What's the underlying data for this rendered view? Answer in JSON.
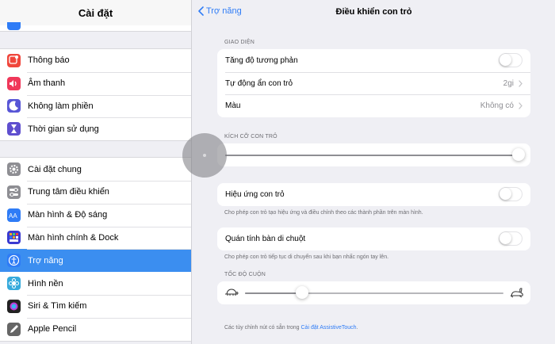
{
  "sidebar": {
    "title": "Cài đặt",
    "group1": [
      {
        "label": "Thông báo",
        "icon": "notifications-icon",
        "color": "#f0463c"
      },
      {
        "label": "Âm thanh",
        "icon": "sounds-icon",
        "color": "#f0385a"
      },
      {
        "label": "Không làm phiền",
        "icon": "do-not-disturb-icon",
        "color": "#5856d6"
      },
      {
        "label": "Thời gian sử dụng",
        "icon": "screen-time-icon",
        "color": "#5f4fcf"
      }
    ],
    "group2": [
      {
        "label": "Cài đặt chung",
        "icon": "gear-icon",
        "color": "#8e8e93"
      },
      {
        "label": "Trung tâm điều khiển",
        "icon": "control-center-icon",
        "color": "#8e8e93"
      },
      {
        "label": "Màn hình & Độ sáng",
        "icon": "display-brightness-icon",
        "color": "#2f7cf6"
      },
      {
        "label": "Màn hình chính & Dock",
        "icon": "home-screen-icon",
        "color": "#3a3ad1"
      },
      {
        "label": "Trợ năng",
        "icon": "accessibility-icon",
        "color": "#2f7cf6",
        "selected": true
      },
      {
        "label": "Hình nền",
        "icon": "wallpaper-icon",
        "color": "#36aadc"
      },
      {
        "label": "Siri & Tìm kiếm",
        "icon": "siri-icon",
        "color": "#222"
      },
      {
        "label": "Apple Pencil",
        "icon": "pencil-icon",
        "color": "#666"
      }
    ]
  },
  "nav": {
    "back_label": "Trợ năng",
    "title": "Điều khiển con trỏ"
  },
  "appearance": {
    "header": "GIAO DIỆN",
    "increase_contrast": {
      "label": "Tăng độ tương phản",
      "on": false
    },
    "auto_hide": {
      "label": "Tự động ẩn con trỏ",
      "value": "2gi"
    },
    "color": {
      "label": "Màu",
      "value": "Không có"
    }
  },
  "pointer_size": {
    "header": "KÍCH CỠ CON TRỎ",
    "level": 1.0
  },
  "pointer_animations": {
    "label": "Hiệu ứng con trỏ",
    "on": false,
    "footer": "Cho phép con trỏ tạo hiệu ứng và điều chỉnh theo các thành phần trên màn hình."
  },
  "trackpad_inertia": {
    "label": "Quán tính bàn di chuột",
    "on": false,
    "footer": "Cho phép con trỏ tiếp tục di chuyển sau khi bạn nhấc ngón tay lên."
  },
  "scroll_speed": {
    "header": "TỐC ĐỘ CUỘN",
    "level": 0.22,
    "slow_icon": "tortoise-icon",
    "fast_icon": "hare-icon"
  },
  "bottom_footer": {
    "prefix": "Các tùy chỉnh nút có sẵn trong ",
    "link": "Cài đặt AssistiveTouch",
    "suffix": "."
  },
  "colors": {
    "accent": "#2f7cf6",
    "selected_row": "#3b8ef0"
  }
}
